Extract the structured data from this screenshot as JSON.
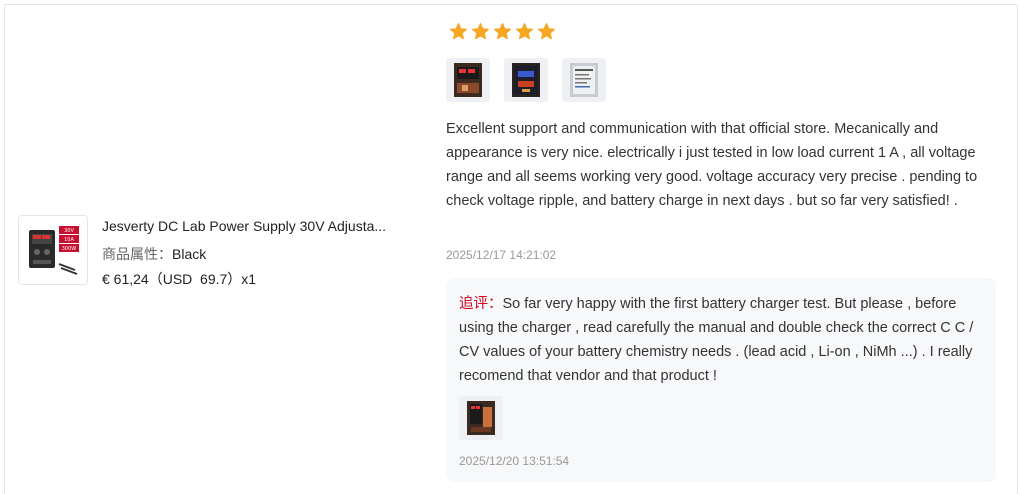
{
  "product": {
    "title": "Jesverty DC Lab Power Supply 30V Adjusta...",
    "attribute_key": "商品属性：",
    "attribute_value": "Black",
    "price": "€ 61,24（USD  69.7）x1",
    "thumbnail_labels": [
      "30V",
      "10A",
      "300W"
    ]
  },
  "review": {
    "rating": 5,
    "text": "Excellent support and communication with that official store. Mecanically and appearance is very nice. electrically i just tested in low load current 1 A , all voltage range and all seems working very good. voltage accuracy very precise . pending to check voltage ripple, and battery charge in next days . but so far very satisfied! .",
    "date": "2025/12/17 14:21:02",
    "photo_count": 3
  },
  "followup": {
    "label": "追评：",
    "text": "So far very happy with the first battery charger test. But please , before using the charger , read carefully the manual and double check the correct C C / CV values of your battery chemistry needs . (lead acid , Li-on , NiMh ...) . I really recomend that vendor and that product !",
    "date": "2025/12/20 13:51:54",
    "photo_count": 1
  },
  "colors": {
    "star": "#f5a623",
    "followup_label": "#d0021b",
    "followup_bg": "#f7f8fa"
  }
}
